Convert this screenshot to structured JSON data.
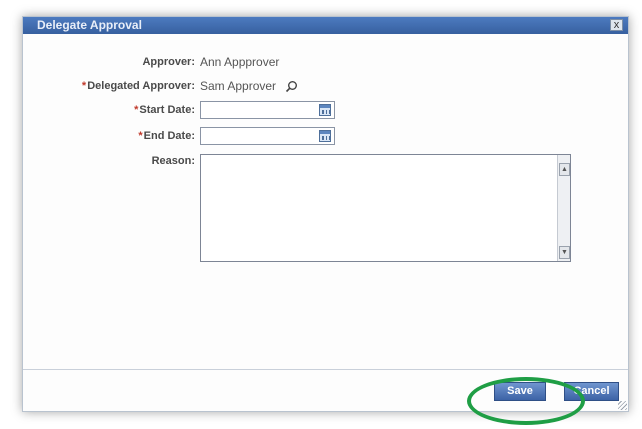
{
  "dialog": {
    "title": "Delegate Approval",
    "close_glyph": "x"
  },
  "form": {
    "required_marker": "*",
    "approver_label": "Approver:",
    "approver_value": "Ann Appprover",
    "delegated_label": "Delegated Approver:",
    "delegated_value": "Sam Approver",
    "start_date_label": "Start Date:",
    "start_date_value": "",
    "end_date_label": "End Date:",
    "end_date_value": "",
    "reason_label": "Reason:",
    "reason_value": ""
  },
  "icons": {
    "lookup": "magnifier-icon",
    "calendar": "calendar-icon"
  },
  "buttons": {
    "save": "Save",
    "cancel": "Cancel"
  },
  "colors": {
    "titlebar": "#4d7bc0",
    "button": "#3c63a6",
    "required": "#c0392b",
    "highlight": "#1f9e45"
  }
}
